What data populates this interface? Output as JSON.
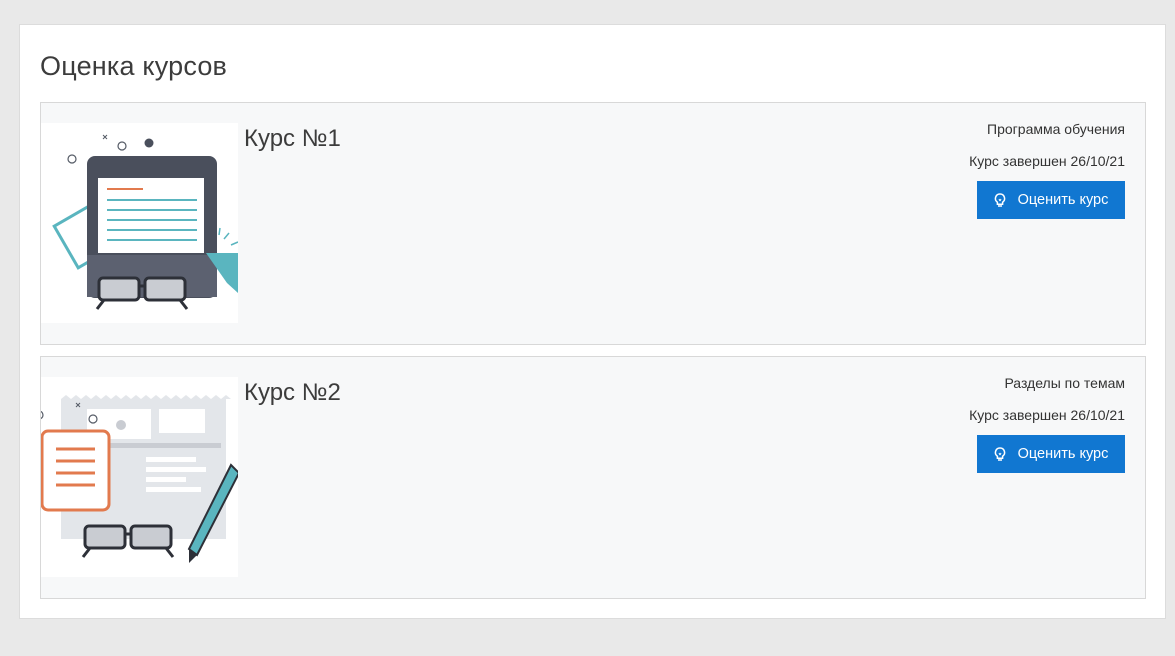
{
  "page": {
    "title": "Оценка курсов"
  },
  "courses": [
    {
      "title": "Курс №1",
      "type": "Программа обучения",
      "status": "Курс завершен 26/10/21",
      "button_label": "Оценить курс",
      "button_icon": "lightbulb-icon",
      "thumbnail_icon": "tablet-glasses-illustration"
    },
    {
      "title": "Курс №2",
      "type": "Разделы по темам",
      "status": "Курс завершен 26/10/21",
      "button_label": "Оценить курс",
      "button_icon": "lightbulb-icon",
      "thumbnail_icon": "document-pen-glasses-illustration"
    }
  ],
  "colors": {
    "accent": "#1177d1",
    "background": "#e9e9e9",
    "card_background": "#f7f8f9"
  }
}
